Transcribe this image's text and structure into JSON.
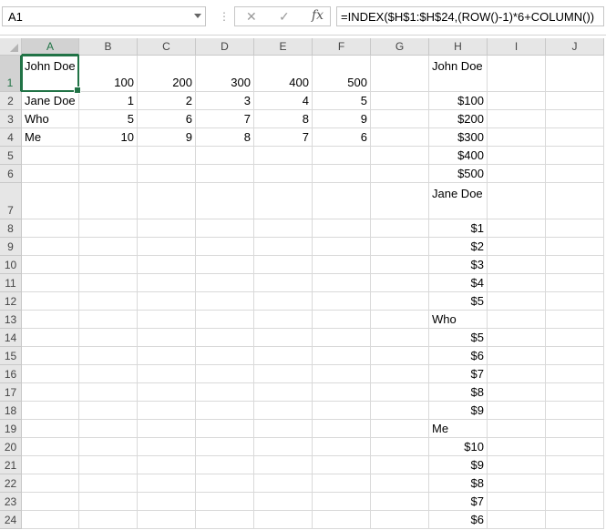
{
  "name_box": {
    "value": "A1"
  },
  "formula_bar": {
    "cancel_glyph": "✕",
    "enter_glyph": "✓",
    "fx_label": "fx",
    "separator": "⋮",
    "formula": "=INDEX($H$1:$H$24,(ROW()-1)*6+COLUMN())"
  },
  "columns": [
    "A",
    "B",
    "C",
    "D",
    "E",
    "F",
    "G",
    "H",
    "I",
    "J"
  ],
  "rows": [
    "1",
    "2",
    "3",
    "4",
    "5",
    "6",
    "7",
    "8",
    "9",
    "10",
    "11",
    "12",
    "13",
    "14",
    "15",
    "16",
    "17",
    "18",
    "19",
    "20",
    "21",
    "22",
    "23",
    "24"
  ],
  "active_cell": "A1",
  "cells": [
    [
      "John Doe",
      "100",
      "200",
      "300",
      "400",
      "500",
      "",
      "John Doe",
      "",
      ""
    ],
    [
      "Jane Doe",
      "1",
      "2",
      "3",
      "4",
      "5",
      "",
      "$100",
      "",
      ""
    ],
    [
      "Who",
      "5",
      "6",
      "7",
      "8",
      "9",
      "",
      "$200",
      "",
      ""
    ],
    [
      "Me",
      "10",
      "9",
      "8",
      "7",
      "6",
      "",
      "$300",
      "",
      ""
    ],
    [
      "",
      "",
      "",
      "",
      "",
      "",
      "",
      "$400",
      "",
      ""
    ],
    [
      "",
      "",
      "",
      "",
      "",
      "",
      "",
      "$500",
      "",
      ""
    ],
    [
      "",
      "",
      "",
      "",
      "",
      "",
      "",
      "Jane Doe",
      "",
      ""
    ],
    [
      "",
      "",
      "",
      "",
      "",
      "",
      "",
      "$1",
      "",
      ""
    ],
    [
      "",
      "",
      "",
      "",
      "",
      "",
      "",
      "$2",
      "",
      ""
    ],
    [
      "",
      "",
      "",
      "",
      "",
      "",
      "",
      "$3",
      "",
      ""
    ],
    [
      "",
      "",
      "",
      "",
      "",
      "",
      "",
      "$4",
      "",
      ""
    ],
    [
      "",
      "",
      "",
      "",
      "",
      "",
      "",
      "$5",
      "",
      ""
    ],
    [
      "",
      "",
      "",
      "",
      "",
      "",
      "",
      "Who",
      "",
      ""
    ],
    [
      "",
      "",
      "",
      "",
      "",
      "",
      "",
      "$5",
      "",
      ""
    ],
    [
      "",
      "",
      "",
      "",
      "",
      "",
      "",
      "$6",
      "",
      ""
    ],
    [
      "",
      "",
      "",
      "",
      "",
      "",
      "",
      "$7",
      "",
      ""
    ],
    [
      "",
      "",
      "",
      "",
      "",
      "",
      "",
      "$8",
      "",
      ""
    ],
    [
      "",
      "",
      "",
      "",
      "",
      "",
      "",
      "$9",
      "",
      ""
    ],
    [
      "",
      "",
      "",
      "",
      "",
      "",
      "",
      "Me",
      "",
      ""
    ],
    [
      "",
      "",
      "",
      "",
      "",
      "",
      "",
      "$10",
      "",
      ""
    ],
    [
      "",
      "",
      "",
      "",
      "",
      "",
      "",
      "$9",
      "",
      ""
    ],
    [
      "",
      "",
      "",
      "",
      "",
      "",
      "",
      "$8",
      "",
      ""
    ],
    [
      "",
      "",
      "",
      "",
      "",
      "",
      "",
      "$7",
      "",
      ""
    ],
    [
      "",
      "",
      "",
      "",
      "",
      "",
      "",
      "$6",
      "",
      ""
    ]
  ],
  "colors": {
    "accent": "#217346",
    "header_bg": "#e6e6e6",
    "gridline": "#d9d9d9"
  }
}
